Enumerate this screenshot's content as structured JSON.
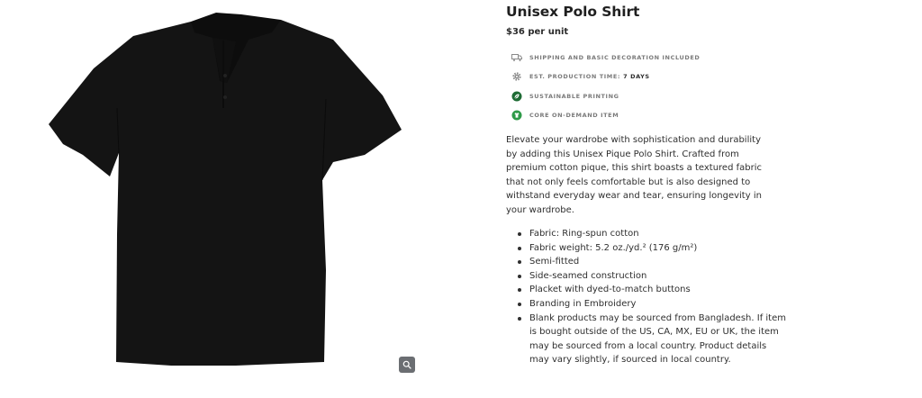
{
  "product": {
    "title": "Unisex Polo Shirt",
    "price": "$36 per unit",
    "image_alt_color": "#141414",
    "zoom_icon": "magnifier-icon"
  },
  "features": [
    {
      "icon": "truck-icon",
      "label": "Shipping and basic decoration included",
      "strong": ""
    },
    {
      "icon": "gear-icon",
      "label": "Est. production time:",
      "strong": "7 days"
    },
    {
      "icon": "leaf-icon",
      "label": "Sustainable printing",
      "strong": ""
    },
    {
      "icon": "shirt-badge-icon",
      "label": "Core on-demand item",
      "strong": ""
    }
  ],
  "colors": {
    "feature_green": "#2e9a48",
    "feature_dark_green": "#1e6b34",
    "icon_gray": "#8a8a8a"
  },
  "description": "Elevate your wardrobe with sophistication and durability by adding this Unisex Pique Polo Shirt. Crafted from premium cotton pique, this shirt boasts a textured fabric that not only feels comfortable but is also designed to withstand everyday wear and tear, ensuring longevity in your wardrobe.",
  "specs": [
    "Fabric: Ring-spun cotton",
    "Fabric weight: 5.2 oz./yd.² (176 g/m²)",
    "Semi-fitted",
    "Side-seamed construction",
    "Placket with dyed-to-match buttons",
    "Branding in Embroidery",
    "Blank products may be sourced from Bangladesh. If item is bought outside of the US, CA, MX, EU or UK, the item may be sourced from a local country. Product details may vary slightly, if sourced in local country."
  ]
}
